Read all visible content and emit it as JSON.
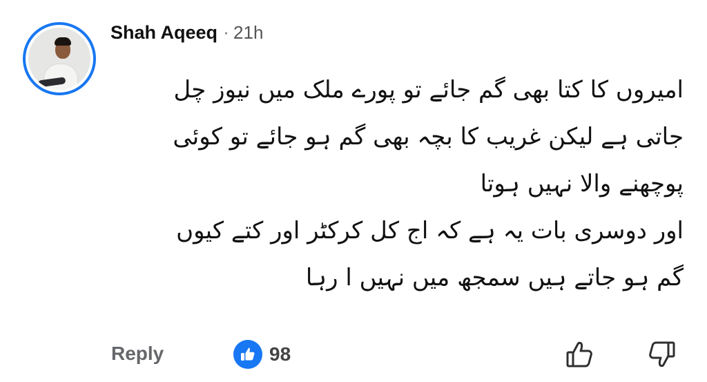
{
  "comment": {
    "author": "Shah Aqeeq",
    "separator": "·",
    "time": "21h",
    "lines": [
      "امیروں کا کتا بھی گم جائے تو پورے ملک میں نیوز چل",
      "جاتی ہے لیکن غریب کا بچہ بھی گم ہو جائے تو کوئی",
      "پوچھنے والا نہیں ہوتا",
      "اور دوسری بات یہ ہے کہ اج کل کرکٹر اور کتے کیوں",
      "گم ہو جاتے ہیں سمجھ میں نہیں ا رہا"
    ]
  },
  "actions": {
    "reply_label": "Reply",
    "like_count": "98"
  },
  "icons": {
    "avatar": "profile-photo",
    "reaction": "thumbs-up-icon",
    "upvote": "thumbs-up-outline-icon",
    "downvote": "thumbs-down-outline-icon"
  },
  "colors": {
    "accent": "#1877f2",
    "secondary_text": "#65676b",
    "primary_text": "#111111"
  }
}
